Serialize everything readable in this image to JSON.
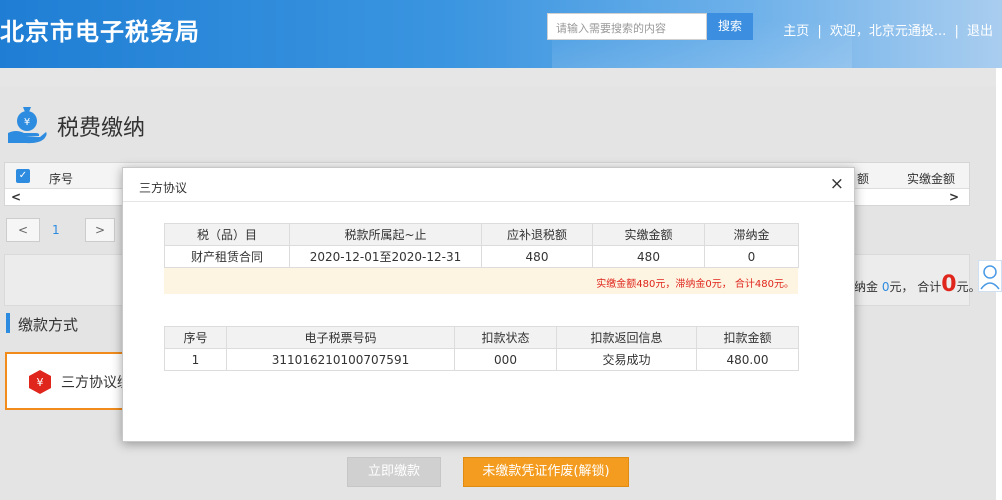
{
  "header": {
    "site_title": "北京市电子税务局",
    "search_placeholder": "请输入需要搜索的内容",
    "search_button": "搜索",
    "nav_home": "主页",
    "nav_sep1": "|",
    "nav_welcome": "欢迎，北京元通投...",
    "nav_sep2": "|",
    "nav_logout": "退出"
  },
  "page": {
    "title": "税费缴纳",
    "table_headers": {
      "index": "序号",
      "paid_amount_partial": "额",
      "paid_amount": "实缴金额"
    },
    "pager": {
      "prev": "<",
      "page": "1",
      "next": ">"
    },
    "summary": {
      "prefix": "纳金 ",
      "late_fee": "0",
      "mid": "元， 合计",
      "total": "0",
      "suffix": "元。"
    },
    "pay_section_title": "缴款方式",
    "pay_method_label": "三方协议缴",
    "btn_pay_now": "立即缴款",
    "btn_void": "未缴款凭证作废(解锁)"
  },
  "modal": {
    "title": "三方协议",
    "close": "×",
    "tax_table": {
      "headers": [
        "税（品）目",
        "税款所属起~止",
        "应补退税额",
        "实缴金额",
        "滞纳金"
      ],
      "rows": [
        [
          "财产租赁合同",
          "2020-12-01至2020-12-31",
          "480",
          "480",
          "0"
        ]
      ],
      "note": "实缴金额480元，滞纳金0元， 合计480元。"
    },
    "result_table": {
      "headers": [
        "序号",
        "电子税票号码",
        "扣款状态",
        "扣款返回信息",
        "扣款金额"
      ],
      "rows": [
        [
          "1",
          "311016210100707591",
          "000",
          "交易成功",
          "480.00"
        ]
      ]
    }
  },
  "colors": {
    "header_blue": "#1f7ed4",
    "accent_blue": "#2d8ce0",
    "orange": "#f39c1f",
    "red": "#e0261c"
  }
}
